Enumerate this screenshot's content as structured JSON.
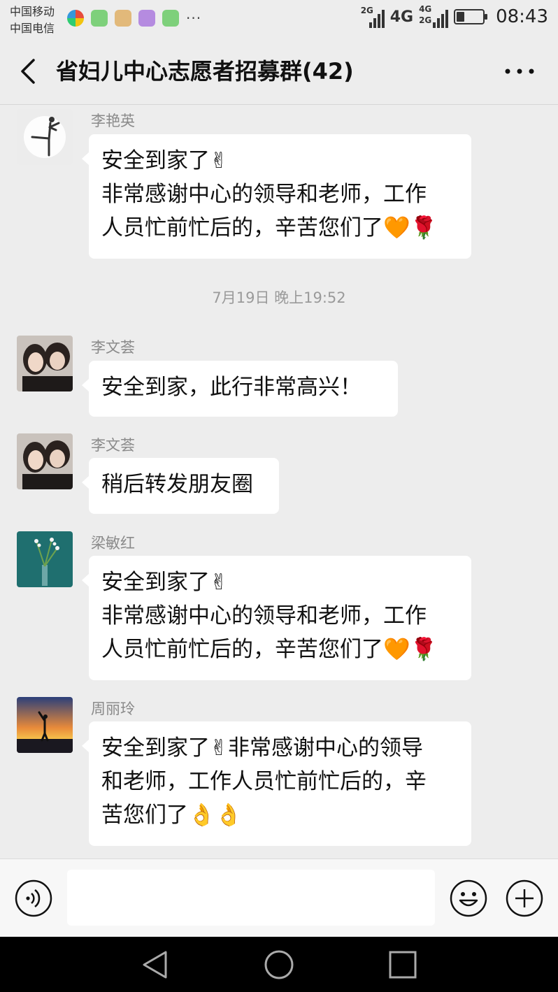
{
  "status_bar": {
    "carrier_1": "中国移动",
    "carrier_2": "中国电信",
    "overflow": "···",
    "signal_1_label": "2G",
    "network_label": "4G",
    "signal_2_label_top": "4G",
    "signal_2_label_bottom": "2G",
    "battery_level_percent": 30,
    "time": "08:43"
  },
  "header": {
    "title": "省妇儿中心志愿者招募群(42)"
  },
  "messages": [
    {
      "sender": "李艳英",
      "lines": [
        "安全到家了✌",
        "非常感谢中心的领导和老师，工作",
        "人员忙前忙后的，辛苦您们了🧡🌹"
      ]
    },
    {
      "sender": "李文荟",
      "lines": [
        "安全到家，此行非常高兴！"
      ]
    },
    {
      "sender": "李文荟",
      "lines": [
        "稍后转发朋友圈"
      ]
    },
    {
      "sender": "梁敏红",
      "lines": [
        "安全到家了✌",
        "非常感谢中心的领导和老师，工作",
        "人员忙前忙后的，辛苦您们了🧡🌹"
      ]
    },
    {
      "sender": "周丽玲",
      "lines": [
        "安全到家了✌非常感谢中心的领导",
        "和老师，工作人员忙前忙后的，辛",
        "苦您们了👌👌"
      ]
    }
  ],
  "timestamp": "7月19日 晚上19:52",
  "input_bar": {
    "placeholder": "",
    "value": ""
  },
  "icons": {
    "back": "chevron-left-icon",
    "more": "more-dots-icon",
    "voice": "voice-icon",
    "emoji": "emoji-icon",
    "plus": "plus-icon",
    "nav_back": "triangle-back-icon",
    "nav_home": "circle-home-icon",
    "nav_recent": "square-recent-icon"
  },
  "colors": {
    "background": "#ededed",
    "bubble": "#ffffff",
    "sender": "#8a8a8a",
    "navbar": "#000000"
  }
}
